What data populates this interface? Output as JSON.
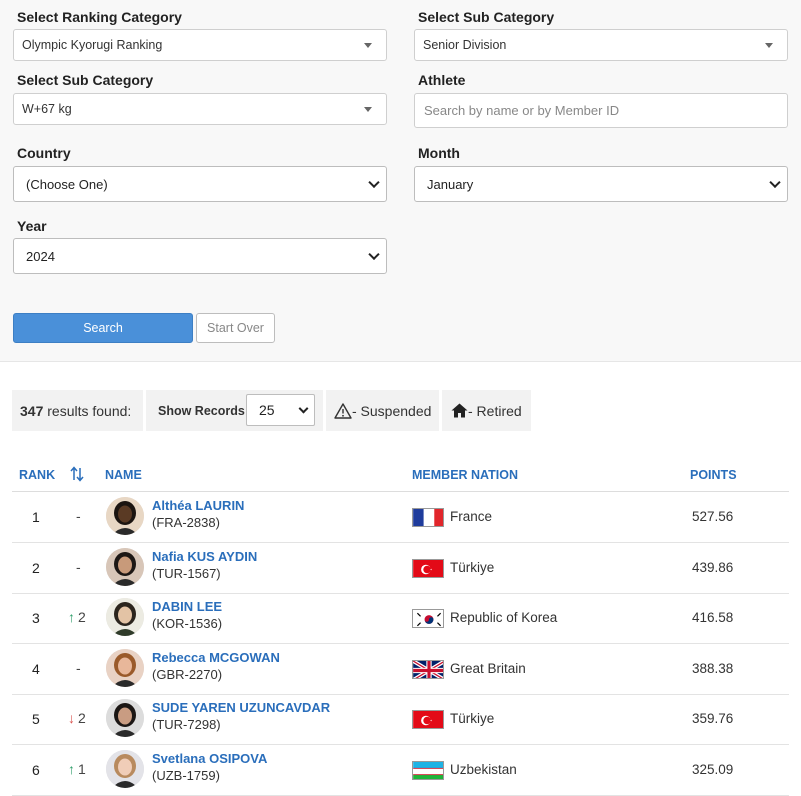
{
  "filters": {
    "ranking_category": {
      "label": "Select Ranking Category",
      "value": "Olympic Kyorugi Ranking"
    },
    "sub_category_1": {
      "label": "Select Sub Category",
      "value": "Senior Division"
    },
    "sub_category_2": {
      "label": "Select Sub Category",
      "value": "W+67 kg"
    },
    "athlete": {
      "label": "Athlete",
      "placeholder": "Search by name or by Member ID"
    },
    "country": {
      "label": "Country",
      "value": "(Choose One)"
    },
    "month": {
      "label": "Month",
      "value": "January"
    },
    "year": {
      "label": "Year",
      "value": "2024"
    },
    "search_label": "Search",
    "start_over_label": "Start Over"
  },
  "info": {
    "count": "347",
    "results_text": "results found:",
    "show_records_label": "Show Records:",
    "show_records_value": "25",
    "suspended_label": "- Suspended",
    "retired_label": "- Retired"
  },
  "table": {
    "headers": {
      "rank": "RANK",
      "name": "NAME",
      "nation": "MEMBER NATION",
      "points": "POINTS"
    },
    "rows": [
      {
        "rank": "1",
        "move_dir": "none",
        "move": "-",
        "name": "Althéa LAURIN",
        "member_id": "(FRA-2838)",
        "nation": "France",
        "flag": "france",
        "points": "527.56"
      },
      {
        "rank": "2",
        "move_dir": "none",
        "move": "-",
        "name": "Nafia KUS AYDIN",
        "member_id": "(TUR-1567)",
        "nation": "Türkiye",
        "flag": "turkey",
        "points": "439.86"
      },
      {
        "rank": "3",
        "move_dir": "up",
        "move": "2",
        "name": "DABIN LEE",
        "member_id": "(KOR-1536)",
        "nation": "Republic of Korea",
        "flag": "korea",
        "points": "416.58"
      },
      {
        "rank": "4",
        "move_dir": "none",
        "move": "-",
        "name": "Rebecca MCGOWAN",
        "member_id": "(GBR-2270)",
        "nation": "Great Britain",
        "flag": "uk",
        "points": "388.38"
      },
      {
        "rank": "5",
        "move_dir": "down",
        "move": "2",
        "name": "SUDE YAREN UZUNCAVDAR",
        "member_id": "(TUR-7298)",
        "nation": "Türkiye",
        "flag": "turkey",
        "points": "359.76"
      },
      {
        "rank": "6",
        "move_dir": "up",
        "move": "1",
        "name": "Svetlana OSIPOVA",
        "member_id": "(UZB-1759)",
        "nation": "Uzbekistan",
        "flag": "uzbekistan",
        "points": "325.09"
      }
    ]
  },
  "colors": {
    "link": "#2a6ebb",
    "search_button": "#4a90d9",
    "up": "#2e9e6a",
    "down": "#d9534f"
  }
}
